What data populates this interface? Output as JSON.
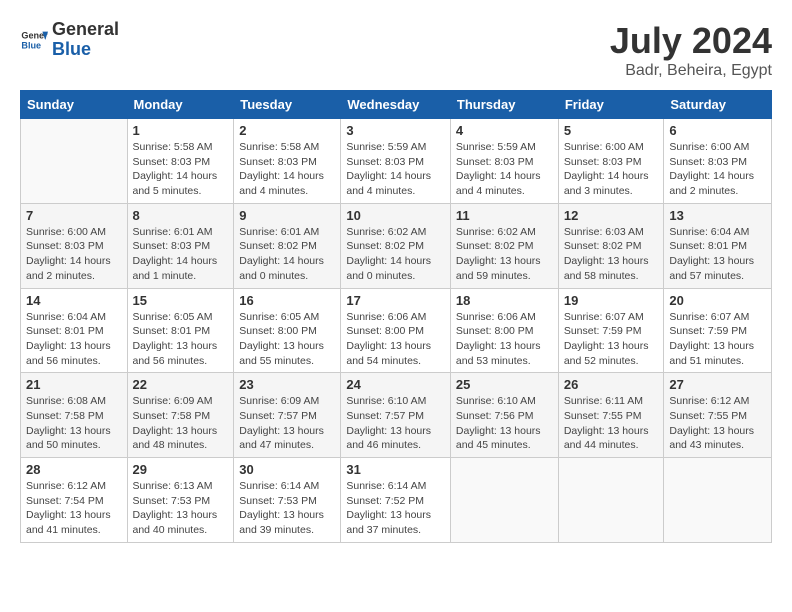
{
  "header": {
    "logo_text_general": "General",
    "logo_text_blue": "Blue",
    "month": "July 2024",
    "location": "Badr, Beheira, Egypt"
  },
  "columns": [
    "Sunday",
    "Monday",
    "Tuesday",
    "Wednesday",
    "Thursday",
    "Friday",
    "Saturday"
  ],
  "weeks": [
    [
      {
        "day": "",
        "detail": ""
      },
      {
        "day": "1",
        "detail": "Sunrise: 5:58 AM\nSunset: 8:03 PM\nDaylight: 14 hours\nand 5 minutes."
      },
      {
        "day": "2",
        "detail": "Sunrise: 5:58 AM\nSunset: 8:03 PM\nDaylight: 14 hours\nand 4 minutes."
      },
      {
        "day": "3",
        "detail": "Sunrise: 5:59 AM\nSunset: 8:03 PM\nDaylight: 14 hours\nand 4 minutes."
      },
      {
        "day": "4",
        "detail": "Sunrise: 5:59 AM\nSunset: 8:03 PM\nDaylight: 14 hours\nand 4 minutes."
      },
      {
        "day": "5",
        "detail": "Sunrise: 6:00 AM\nSunset: 8:03 PM\nDaylight: 14 hours\nand 3 minutes."
      },
      {
        "day": "6",
        "detail": "Sunrise: 6:00 AM\nSunset: 8:03 PM\nDaylight: 14 hours\nand 2 minutes."
      }
    ],
    [
      {
        "day": "7",
        "detail": "Sunrise: 6:00 AM\nSunset: 8:03 PM\nDaylight: 14 hours\nand 2 minutes."
      },
      {
        "day": "8",
        "detail": "Sunrise: 6:01 AM\nSunset: 8:03 PM\nDaylight: 14 hours\nand 1 minute."
      },
      {
        "day": "9",
        "detail": "Sunrise: 6:01 AM\nSunset: 8:02 PM\nDaylight: 14 hours\nand 0 minutes."
      },
      {
        "day": "10",
        "detail": "Sunrise: 6:02 AM\nSunset: 8:02 PM\nDaylight: 14 hours\nand 0 minutes."
      },
      {
        "day": "11",
        "detail": "Sunrise: 6:02 AM\nSunset: 8:02 PM\nDaylight: 13 hours\nand 59 minutes."
      },
      {
        "day": "12",
        "detail": "Sunrise: 6:03 AM\nSunset: 8:02 PM\nDaylight: 13 hours\nand 58 minutes."
      },
      {
        "day": "13",
        "detail": "Sunrise: 6:04 AM\nSunset: 8:01 PM\nDaylight: 13 hours\nand 57 minutes."
      }
    ],
    [
      {
        "day": "14",
        "detail": "Sunrise: 6:04 AM\nSunset: 8:01 PM\nDaylight: 13 hours\nand 56 minutes."
      },
      {
        "day": "15",
        "detail": "Sunrise: 6:05 AM\nSunset: 8:01 PM\nDaylight: 13 hours\nand 56 minutes."
      },
      {
        "day": "16",
        "detail": "Sunrise: 6:05 AM\nSunset: 8:00 PM\nDaylight: 13 hours\nand 55 minutes."
      },
      {
        "day": "17",
        "detail": "Sunrise: 6:06 AM\nSunset: 8:00 PM\nDaylight: 13 hours\nand 54 minutes."
      },
      {
        "day": "18",
        "detail": "Sunrise: 6:06 AM\nSunset: 8:00 PM\nDaylight: 13 hours\nand 53 minutes."
      },
      {
        "day": "19",
        "detail": "Sunrise: 6:07 AM\nSunset: 7:59 PM\nDaylight: 13 hours\nand 52 minutes."
      },
      {
        "day": "20",
        "detail": "Sunrise: 6:07 AM\nSunset: 7:59 PM\nDaylight: 13 hours\nand 51 minutes."
      }
    ],
    [
      {
        "day": "21",
        "detail": "Sunrise: 6:08 AM\nSunset: 7:58 PM\nDaylight: 13 hours\nand 50 minutes."
      },
      {
        "day": "22",
        "detail": "Sunrise: 6:09 AM\nSunset: 7:58 PM\nDaylight: 13 hours\nand 48 minutes."
      },
      {
        "day": "23",
        "detail": "Sunrise: 6:09 AM\nSunset: 7:57 PM\nDaylight: 13 hours\nand 47 minutes."
      },
      {
        "day": "24",
        "detail": "Sunrise: 6:10 AM\nSunset: 7:57 PM\nDaylight: 13 hours\nand 46 minutes."
      },
      {
        "day": "25",
        "detail": "Sunrise: 6:10 AM\nSunset: 7:56 PM\nDaylight: 13 hours\nand 45 minutes."
      },
      {
        "day": "26",
        "detail": "Sunrise: 6:11 AM\nSunset: 7:55 PM\nDaylight: 13 hours\nand 44 minutes."
      },
      {
        "day": "27",
        "detail": "Sunrise: 6:12 AM\nSunset: 7:55 PM\nDaylight: 13 hours\nand 43 minutes."
      }
    ],
    [
      {
        "day": "28",
        "detail": "Sunrise: 6:12 AM\nSunset: 7:54 PM\nDaylight: 13 hours\nand 41 minutes."
      },
      {
        "day": "29",
        "detail": "Sunrise: 6:13 AM\nSunset: 7:53 PM\nDaylight: 13 hours\nand 40 minutes."
      },
      {
        "day": "30",
        "detail": "Sunrise: 6:14 AM\nSunset: 7:53 PM\nDaylight: 13 hours\nand 39 minutes."
      },
      {
        "day": "31",
        "detail": "Sunrise: 6:14 AM\nSunset: 7:52 PM\nDaylight: 13 hours\nand 37 minutes."
      },
      {
        "day": "",
        "detail": ""
      },
      {
        "day": "",
        "detail": ""
      },
      {
        "day": "",
        "detail": ""
      }
    ]
  ]
}
